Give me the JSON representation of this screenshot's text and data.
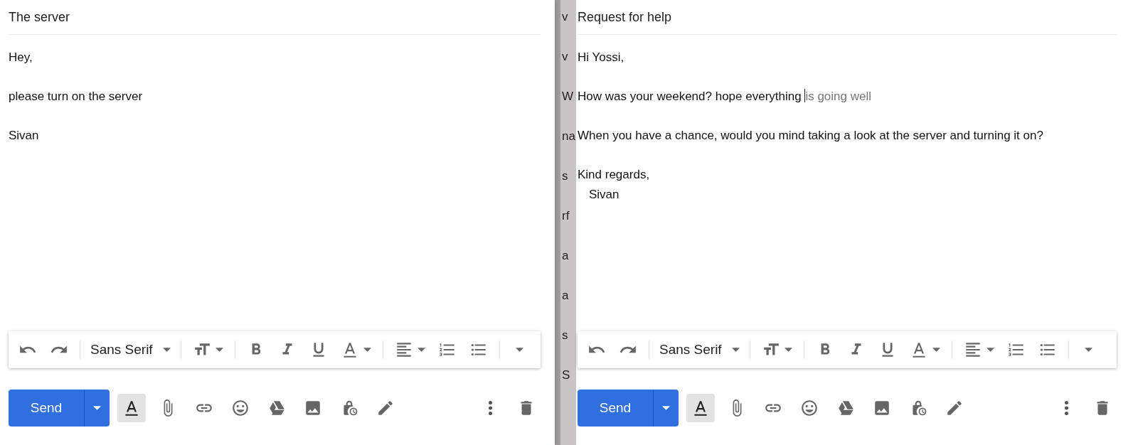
{
  "composes": [
    {
      "subject": "The server",
      "body": [
        {
          "lines": [
            {
              "text": "Hey,",
              "kind": "plain"
            }
          ]
        },
        {
          "lines": [
            {
              "text": "please turn on the server",
              "kind": "plain"
            }
          ]
        },
        {
          "lines": [
            {
              "text": "Sivan",
              "kind": "plain"
            }
          ]
        }
      ],
      "toolbar": [
        {
          "kind": "undo"
        },
        {
          "kind": "redo"
        },
        {
          "kind": "divider"
        },
        {
          "kind": "font",
          "label": "Sans Serif"
        },
        {
          "kind": "divider"
        },
        {
          "kind": "size"
        },
        {
          "kind": "divider"
        },
        {
          "kind": "bold"
        },
        {
          "kind": "italic"
        },
        {
          "kind": "underline"
        },
        {
          "kind": "color"
        },
        {
          "kind": "divider"
        },
        {
          "kind": "align"
        },
        {
          "kind": "numbered"
        },
        {
          "kind": "bulleted"
        },
        {
          "kind": "divider"
        },
        {
          "kind": "more"
        }
      ],
      "send": {
        "label": "Send"
      },
      "actions": [
        {
          "kind": "formatting",
          "selected": true
        },
        {
          "kind": "attach",
          "selected": false
        },
        {
          "kind": "link",
          "selected": false
        },
        {
          "kind": "emoji",
          "selected": false
        },
        {
          "kind": "drive",
          "selected": false
        },
        {
          "kind": "photo",
          "selected": false
        },
        {
          "kind": "confidential",
          "selected": false
        },
        {
          "kind": "signature",
          "selected": false
        }
      ]
    },
    {
      "subject": "Request for help",
      "body": [
        {
          "lines": [
            {
              "text": "Hi Yossi,",
              "kind": "plain"
            }
          ]
        },
        {
          "lines": [
            {
              "text": "How was your weekend? hope everything ",
              "kind": "plain",
              "suggestion": "is going well"
            }
          ]
        },
        {
          "lines": [
            {
              "text": "When you have a chance, would you mind taking a look at the server and turning it on?",
              "kind": "plain"
            }
          ]
        },
        {
          "lines": [
            {
              "text": "Kind regards,",
              "kind": "plain"
            },
            {
              "text": "Sivan",
              "kind": "indented"
            }
          ]
        }
      ],
      "toolbar": [
        {
          "kind": "undo"
        },
        {
          "kind": "redo"
        },
        {
          "kind": "divider"
        },
        {
          "kind": "font",
          "label": "Sans Serif"
        },
        {
          "kind": "divider"
        },
        {
          "kind": "size"
        },
        {
          "kind": "divider"
        },
        {
          "kind": "bold"
        },
        {
          "kind": "italic"
        },
        {
          "kind": "underline"
        },
        {
          "kind": "color"
        },
        {
          "kind": "divider"
        },
        {
          "kind": "align"
        },
        {
          "kind": "numbered"
        },
        {
          "kind": "bulleted"
        },
        {
          "kind": "divider"
        },
        {
          "kind": "more"
        }
      ],
      "send": {
        "label": "Send"
      },
      "actions": [
        {
          "kind": "formatting",
          "selected": true
        },
        {
          "kind": "attach",
          "selected": false
        },
        {
          "kind": "link",
          "selected": false
        },
        {
          "kind": "emoji",
          "selected": false
        },
        {
          "kind": "drive",
          "selected": false
        },
        {
          "kind": "photo",
          "selected": false
        },
        {
          "kind": "confidential",
          "selected": false
        },
        {
          "kind": "signature",
          "selected": false
        }
      ]
    }
  ],
  "background_fragments": [
    "v",
    "v",
    "W",
    "na",
    "s",
    "rf",
    "a",
    "a",
    "s",
    "S"
  ]
}
